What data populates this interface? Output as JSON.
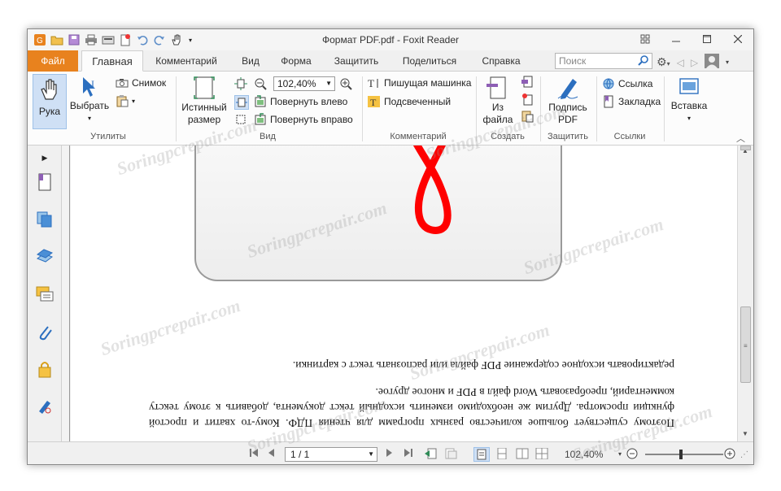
{
  "window": {
    "title": "Формат PDF.pdf - Foxit Reader"
  },
  "tabs": {
    "file": "Файл",
    "items": [
      "Главная",
      "Комментарий",
      "Вид",
      "Форма",
      "Защитить",
      "Поделиться",
      "Справка"
    ]
  },
  "search": {
    "placeholder": "Поиск"
  },
  "ribbon": {
    "hand": "Рука",
    "select": "Выбрать",
    "snapshot": "Снимок",
    "actual_size_line1": "Истинный",
    "actual_size_line2": "размер",
    "zoom_value": "102,40%",
    "rotate_left": "Повернуть влево",
    "rotate_right": "Повернуть вправо",
    "typewriter": "Пишущая машинка",
    "highlight": "Подсвеченный",
    "from_file_line1": "Из",
    "from_file_line2": "файла",
    "sign_line1": "Подпись",
    "sign_line2": "PDF",
    "link": "Ссылка",
    "bookmark": "Закладка",
    "insert": "Вставка",
    "groups": {
      "tools": "Утилиты",
      "view": "Вид",
      "comment": "Комментарий",
      "create": "Создать",
      "protect": "Защитить",
      "links": "Ссылки"
    }
  },
  "document": {
    "para1_line1": "редактировать исходное содержание PDF файла или распознать текст с картинки.",
    "para2": "Поэтому существует большое количество разных программ для чтения ПДФ. Кому-то хватит и простой функции просмотра. Другим же необходимо изменить исходный текст документа, добавить к этому тексту комментарий, преобразовать Word файл в PDF и многое другое."
  },
  "status": {
    "page": "1 / 1",
    "zoom": "102,40%"
  },
  "watermark": "Soringpcrepair.com",
  "colors": {
    "file_tab": "#e8821e",
    "pdf_logo": "#ff0000",
    "accent": "#2c6fbf"
  }
}
